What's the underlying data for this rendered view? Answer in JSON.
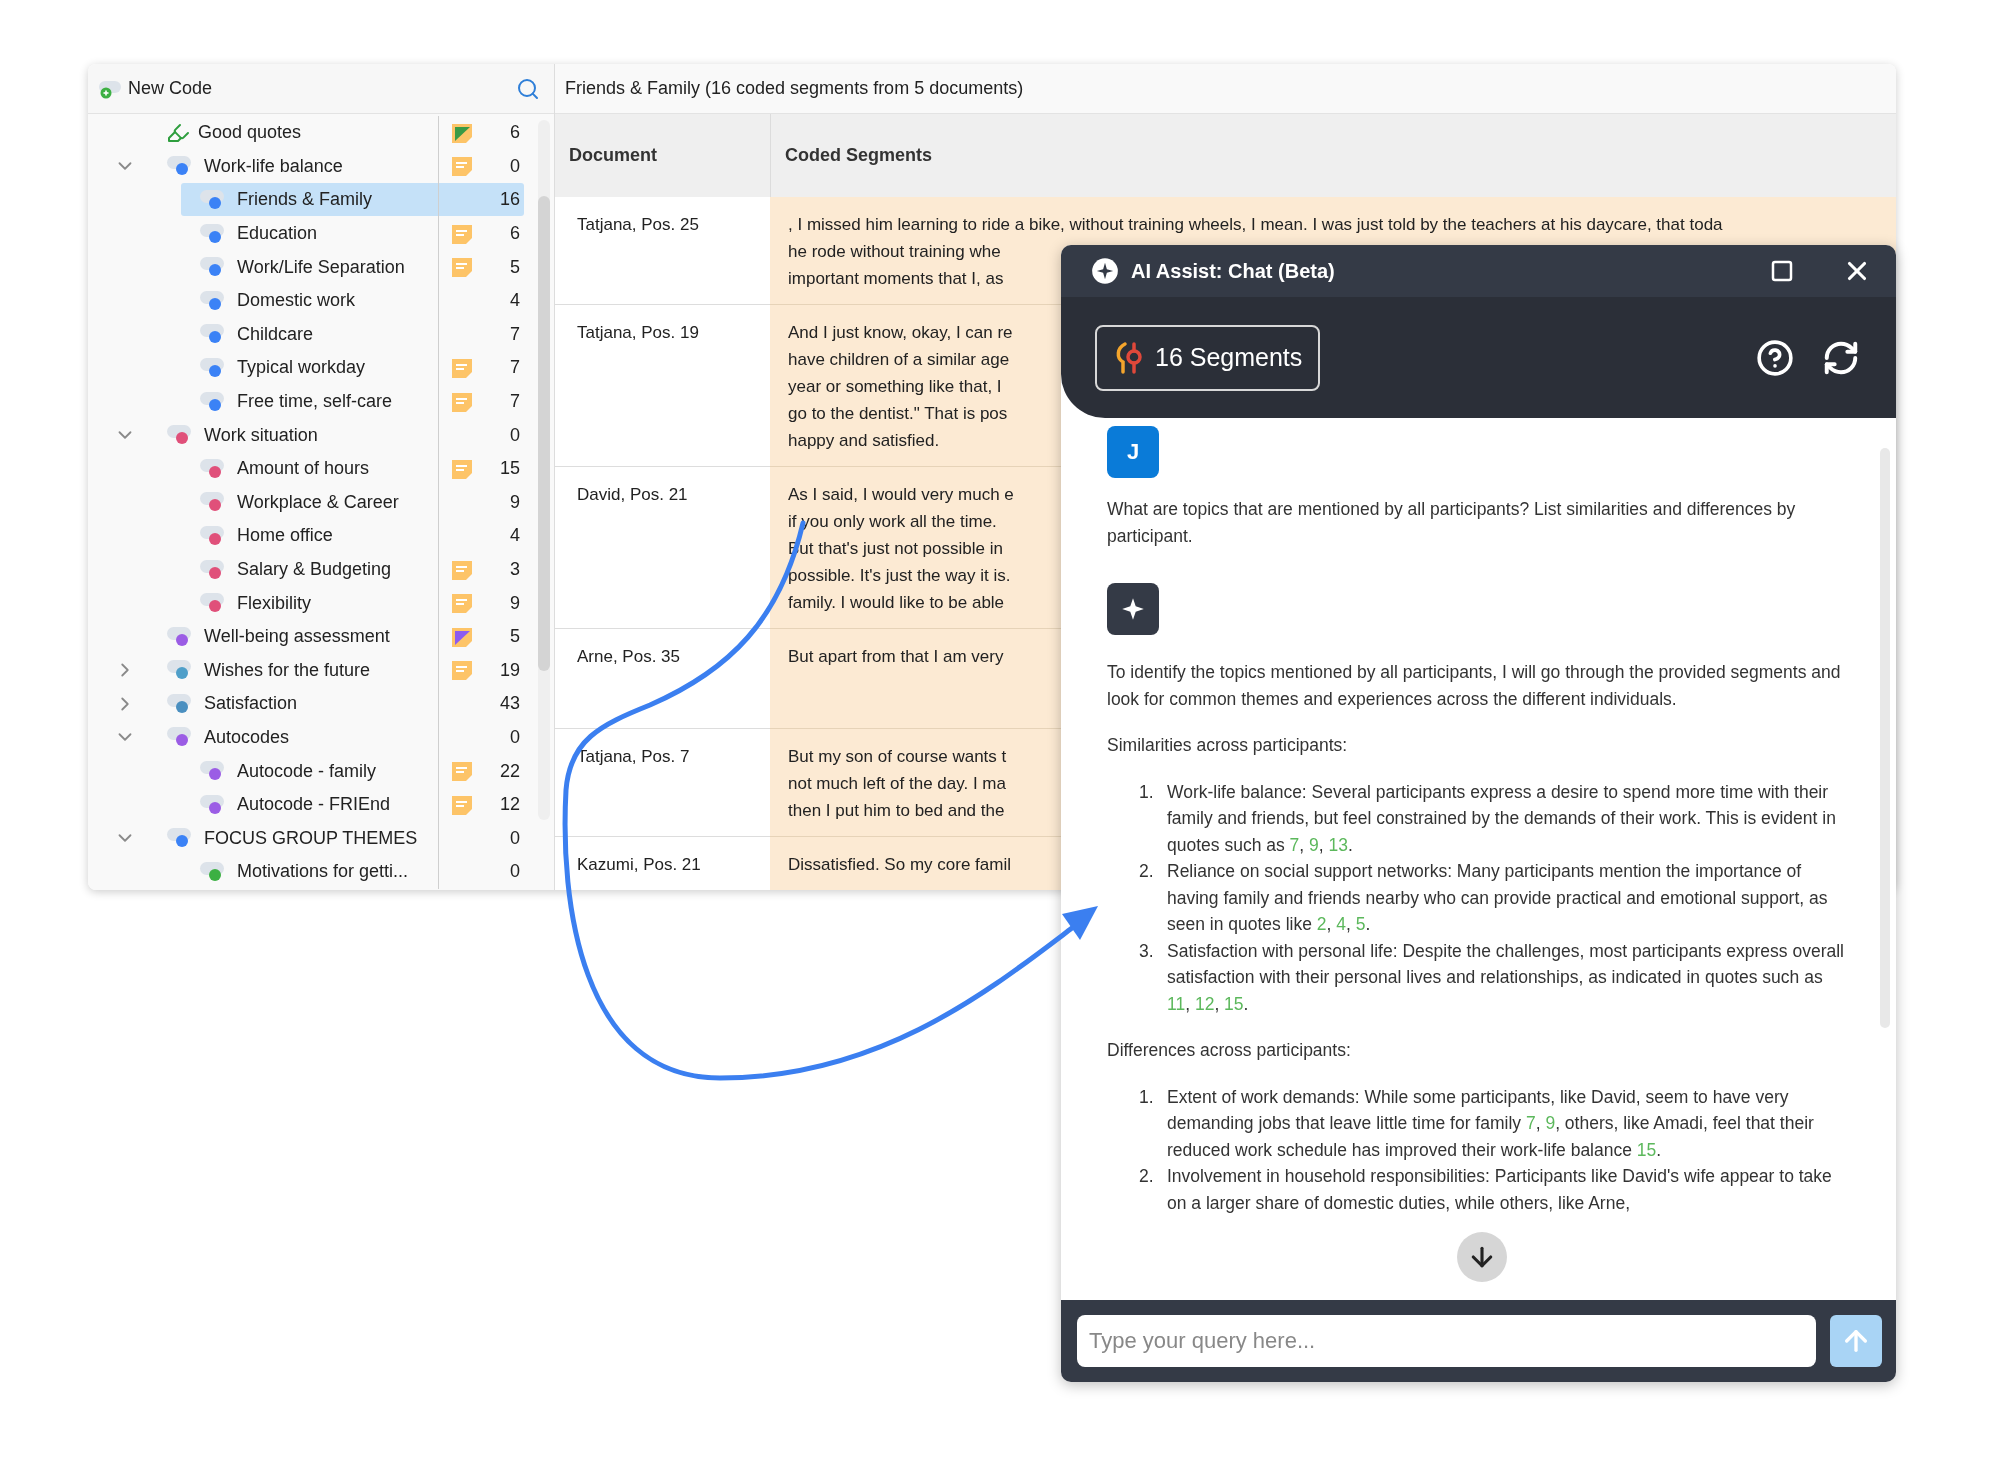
{
  "code_panel": {
    "new_code_label": "New Code",
    "codes": [
      {
        "label": "Good quotes",
        "kind": "highlighter",
        "memo": {
          "kind": "green"
        },
        "count": "6",
        "selected": false
      },
      {
        "label": "Work-life balance",
        "kind": "code",
        "color": "#3b82f6",
        "memo": {
          "kind": "lines"
        },
        "count": "0",
        "selected": false,
        "expanded": true,
        "children": [
          {
            "label": "Friends & Family",
            "kind": "code",
            "color": "#3b82f6",
            "count": "16",
            "selected": true
          },
          {
            "label": "Education",
            "kind": "code",
            "color": "#3b82f6",
            "memo": {
              "kind": "lines"
            },
            "count": "6",
            "selected": false
          },
          {
            "label": "Work/Life Separation",
            "kind": "code",
            "color": "#3b82f6",
            "memo": {
              "kind": "lines"
            },
            "count": "5",
            "selected": false
          },
          {
            "label": "Domestic work",
            "kind": "code",
            "color": "#3b82f6",
            "count": "4",
            "selected": false
          },
          {
            "label": "Childcare",
            "kind": "code",
            "color": "#3b82f6",
            "count": "7",
            "selected": false
          },
          {
            "label": "Typical workday",
            "kind": "code",
            "color": "#3b82f6",
            "memo": {
              "kind": "lines"
            },
            "count": "7",
            "selected": false
          },
          {
            "label": "Free time, self-care",
            "kind": "code",
            "color": "#3b82f6",
            "memo": {
              "kind": "lines"
            },
            "count": "7",
            "selected": false
          }
        ]
      },
      {
        "label": "Work situation",
        "kind": "code",
        "color": "#e0507a",
        "count": "0",
        "selected": false,
        "expanded": true,
        "children": [
          {
            "label": "Amount of hours",
            "kind": "code",
            "color": "#e0507a",
            "memo": {
              "kind": "lines"
            },
            "count": "15",
            "selected": false
          },
          {
            "label": "Workplace & Career",
            "kind": "code",
            "color": "#e0507a",
            "count": "9",
            "selected": false
          },
          {
            "label": "Home office",
            "kind": "code",
            "color": "#e0507a",
            "count": "4",
            "selected": false
          },
          {
            "label": "Salary & Budgeting",
            "kind": "code",
            "color": "#e0507a",
            "memo": {
              "kind": "lines"
            },
            "count": "3",
            "selected": false
          },
          {
            "label": "Flexibility",
            "kind": "code",
            "color": "#e0507a",
            "memo": {
              "kind": "lines"
            },
            "count": "9",
            "selected": false
          }
        ]
      },
      {
        "label": "Well-being assessment",
        "kind": "code",
        "color": "#9b5de5",
        "memo": {
          "kind": "purple"
        },
        "count": "5",
        "selected": false
      },
      {
        "label": "Wishes for the future",
        "kind": "code",
        "color": "#4f9fc9",
        "memo": {
          "kind": "lines"
        },
        "count": "19",
        "selected": false,
        "expanded": false
      },
      {
        "label": "Satisfaction",
        "kind": "code",
        "color": "#4a8fc0",
        "count": "43",
        "selected": false,
        "expanded": false
      },
      {
        "label": "Autocodes",
        "kind": "code",
        "color": "#9b5de5",
        "count": "0",
        "selected": false,
        "expanded": true,
        "children": [
          {
            "label": "Autocode - family",
            "kind": "code",
            "color": "#9b5de5",
            "memo": {
              "kind": "lines"
            },
            "count": "22",
            "selected": false
          },
          {
            "label": "Autocode - FRIEnd",
            "kind": "code",
            "color": "#9b5de5",
            "memo": {
              "kind": "lines"
            },
            "count": "12",
            "selected": false
          }
        ]
      },
      {
        "label": "FOCUS GROUP THEMES",
        "kind": "code",
        "color": "#3b82f6",
        "count": "0",
        "selected": false,
        "expanded": true,
        "children": [
          {
            "label": "Motivations for getti...",
            "kind": "code",
            "color": "#3cb043",
            "count": "0",
            "selected": false
          }
        ]
      }
    ]
  },
  "segments_panel": {
    "title": "Friends & Family (16 coded segments from 5 documents)",
    "columns": [
      "Document",
      "Coded Segments"
    ],
    "rows": [
      {
        "document": "Tatjana, Pos. 25",
        "lines": [
          ", I missed him learning to ride a bike, without training wheels, I mean. I was just told by the teachers at his daycare, that toda",
          "he rode without training whe",
          "important moments that I, as"
        ]
      },
      {
        "document": "Tatjana, Pos. 19",
        "lines": [
          "And I just know, okay, I can re",
          "have children of a similar age",
          "year or something like that, I",
          "go to the dentist.\" That is pos",
          "happy and satisfied."
        ]
      },
      {
        "document": "David, Pos. 21",
        "lines": [
          "As I said, I would very much e",
          "if you only work all the time.",
          "But that's just not possible in",
          "possible. It's just the way it is.",
          "family. I would like to be able"
        ]
      },
      {
        "document": "Arne, Pos. 35",
        "lines": [
          "But apart from that I am very"
        ]
      },
      {
        "document": "Tatjana, Pos. 7",
        "lines": [
          "But my son of course wants t",
          "not much left of the day. I ma",
          "then I put him to bed and the"
        ]
      },
      {
        "document": "Kazumi, Pos. 21",
        "lines": [
          "Dissatisfied. So my core famil"
        ]
      }
    ]
  },
  "chat": {
    "title": "AI Assist: Chat (Beta)",
    "segments_button": "16 Segments",
    "messages": [
      {
        "kind": "user",
        "avatar": "J",
        "blocks": [
          {
            "kind": "paragraph",
            "parts": [
              {
                "text": "What are topics that are mentioned by all participants? List similarities and differences by participant."
              }
            ]
          }
        ]
      },
      {
        "kind": "assistant",
        "blocks": [
          {
            "kind": "paragraph",
            "parts": [
              {
                "text": "To identify the topics mentioned by all participants, I will go through the provided segments and look for common themes and experiences across the different individuals."
              }
            ]
          },
          {
            "kind": "paragraph",
            "parts": [
              {
                "text": "Similarities across participants:"
              }
            ]
          },
          {
            "kind": "list",
            "items": [
              {
                "number": "1.",
                "parts": [
                  {
                    "text": "Work-life balance: Several participants express a desire to spend more time with their family and friends, but feel constrained by the demands of their work. This is evident in quotes such as "
                  },
                  {
                    "ref": "7"
                  },
                  {
                    "text": ", "
                  },
                  {
                    "ref": "9"
                  },
                  {
                    "text": ", "
                  },
                  {
                    "ref": "13"
                  },
                  {
                    "text": "."
                  }
                ]
              },
              {
                "number": "2.",
                "parts": [
                  {
                    "text": "Reliance on social support networks: Many participants mention the importance of having family and friends nearby who can provide practical and emotional support, as seen in quotes like "
                  },
                  {
                    "ref": "2"
                  },
                  {
                    "text": ", "
                  },
                  {
                    "ref": "4"
                  },
                  {
                    "text": ", "
                  },
                  {
                    "ref": "5"
                  },
                  {
                    "text": "."
                  }
                ]
              },
              {
                "number": "3.",
                "parts": [
                  {
                    "text": "Satisfaction with personal life: Despite the challenges, most participants express overall satisfaction with their personal lives and relationships, as indicated in quotes such as "
                  },
                  {
                    "ref": "11"
                  },
                  {
                    "text": ", "
                  },
                  {
                    "ref": "12"
                  },
                  {
                    "text": ", "
                  },
                  {
                    "ref": "15"
                  },
                  {
                    "text": "."
                  }
                ]
              }
            ]
          },
          {
            "kind": "paragraph",
            "parts": [
              {
                "text": "Differences across participants:"
              }
            ]
          },
          {
            "kind": "list",
            "items": [
              {
                "number": "1.",
                "parts": [
                  {
                    "text": "Extent of work demands: While some participants, like David, seem to have very demanding jobs that leave little time for family "
                  },
                  {
                    "ref": "7"
                  },
                  {
                    "text": ", "
                  },
                  {
                    "ref": "9"
                  },
                  {
                    "text": ", others, like Amadi, feel that their reduced work schedule has improved their work-life balance "
                  },
                  {
                    "ref": "15"
                  },
                  {
                    "text": "."
                  }
                ]
              },
              {
                "number": "2.",
                "parts": [
                  {
                    "text": "Involvement in household responsibilities: Participants like David's wife appear to take on a larger share of domestic duties, while others, like Arne,"
                  }
                ]
              }
            ]
          }
        ]
      }
    ],
    "input": {
      "placeholder": "Type your query here..."
    }
  }
}
